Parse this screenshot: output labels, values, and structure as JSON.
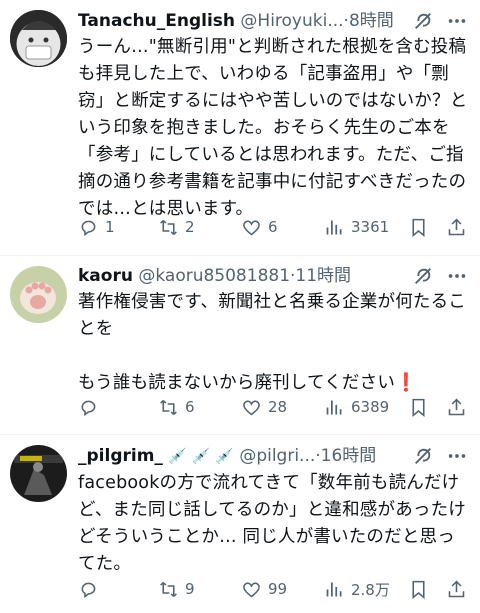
{
  "tweets": [
    {
      "name": "Tanachu_English",
      "handle": "@Hiroyuki...",
      "time": "·8時間",
      "body": "うーん…\"無断引用\"と判断された根拠を含む投稿も拝見した上で、いわゆる「記事盗用」や「剽窃」と断定するにはやや苦しいのではないか？という印象を抱きました。おそらく先生のご本を「参考」にしているとは思われます。ただ、ご指摘の通り参考書籍を記事中に付記すべきだったのでは…とは思います。",
      "replies": "1",
      "retweets": "2",
      "likes": "6",
      "views": "3361"
    },
    {
      "name": "kaoru",
      "handle": "@kaoru85081881",
      "time": "·11時間",
      "body_line1": "著作権侵害です、新聞社と名乗る企業が何たることを",
      "body_line2": "もう誰も読まないから廃刊してください",
      "body_emoji": "❗",
      "replies": "",
      "retweets": "6",
      "likes": "28",
      "views": "6389"
    },
    {
      "name": "_pilgrim_",
      "name_emoji": "💉 💉 💉",
      "handle": "@pilgri...",
      "time": "·16時間",
      "body": "facebookの方で流れてきて「数年前も読んだけど、また同じ話してるのか」と違和感があったけどそういうことか… 同じ人が書いたのだと思ってた。",
      "replies": "",
      "retweets": "9",
      "likes": "99",
      "views": "2.8万"
    }
  ],
  "icons": [
    "reply-icon",
    "retweet-icon",
    "like-icon",
    "views-icon",
    "bookmark-icon",
    "share-icon",
    "grok-icon",
    "more-icon"
  ],
  "colors": {
    "text": "#0f1419",
    "secondary": "#536471",
    "divider": "#eff3f4"
  }
}
